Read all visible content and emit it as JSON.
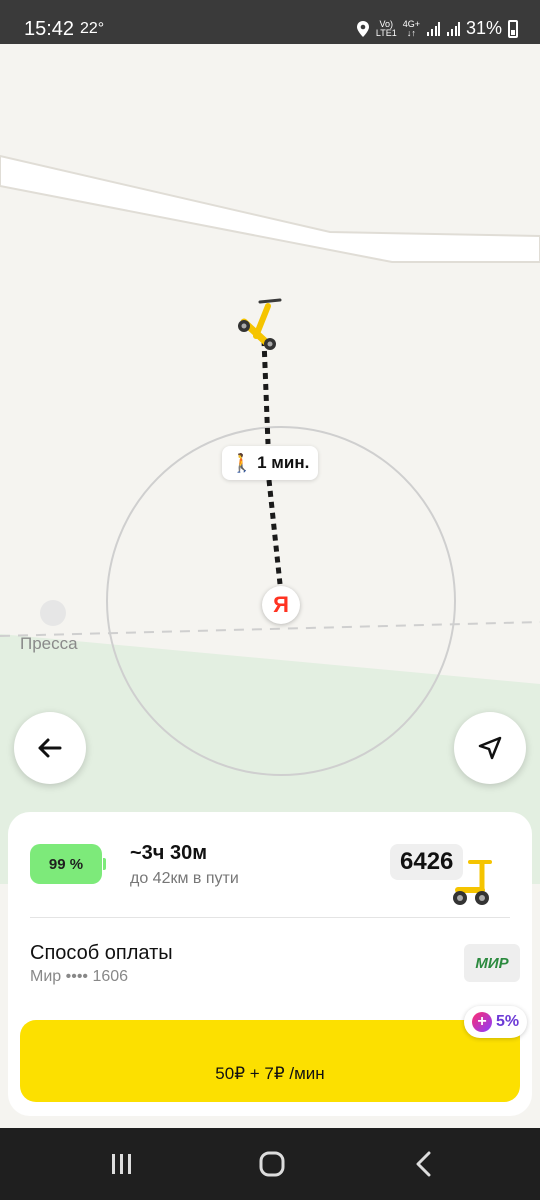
{
  "status_bar": {
    "time": "15:42",
    "temperature": "22°",
    "network_top": "Vo)",
    "network_bottom": "LTE1",
    "network_4g": "4G+",
    "battery_percent": "31%"
  },
  "map": {
    "poi_label": "Пресса",
    "walk_time": "1 мин.",
    "user_pin_letter": "Я"
  },
  "ride": {
    "battery_level": "99 %",
    "range_time": "~3ч 30м",
    "range_distance": "до 42км в пути",
    "scooter_number": "6426"
  },
  "payment": {
    "title": "Способ оплаты",
    "card": "Мир •••• 1606",
    "logo_text": "МИР"
  },
  "cta": {
    "price_label": "50₽ + 7₽ /мин",
    "cashback": "5%"
  },
  "colors": {
    "accent_yellow": "#fce000",
    "battery_green": "#7dea7a",
    "yandex_red": "#ff3322",
    "plus_purple": "#6c3ad6"
  }
}
